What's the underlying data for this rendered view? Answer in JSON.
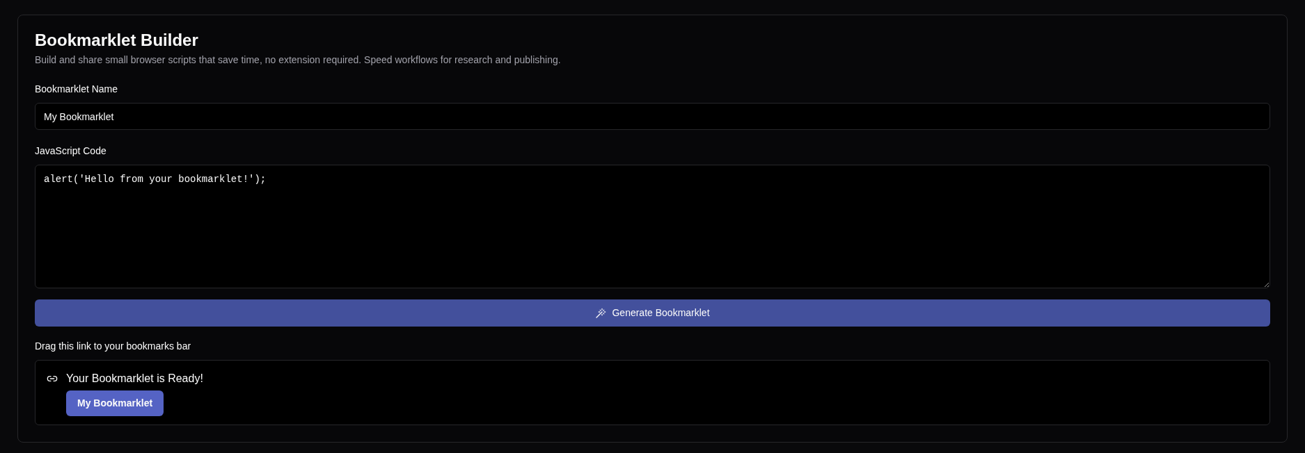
{
  "header": {
    "title": "Bookmarklet Builder",
    "subtitle": "Build and share small browser scripts that save time, no extension required. Speed workflows for research and publishing."
  },
  "name_field": {
    "label": "Bookmarklet Name",
    "value": "My Bookmarklet"
  },
  "code_field": {
    "label": "JavaScript Code",
    "value": "alert('Hello from your bookmarklet!');"
  },
  "generate_button": {
    "label": "Generate Bookmarklet"
  },
  "result": {
    "label": "Drag this link to your bookmarks bar",
    "title": "Your Bookmarklet is Ready!",
    "link": "My Bookmarklet"
  }
}
